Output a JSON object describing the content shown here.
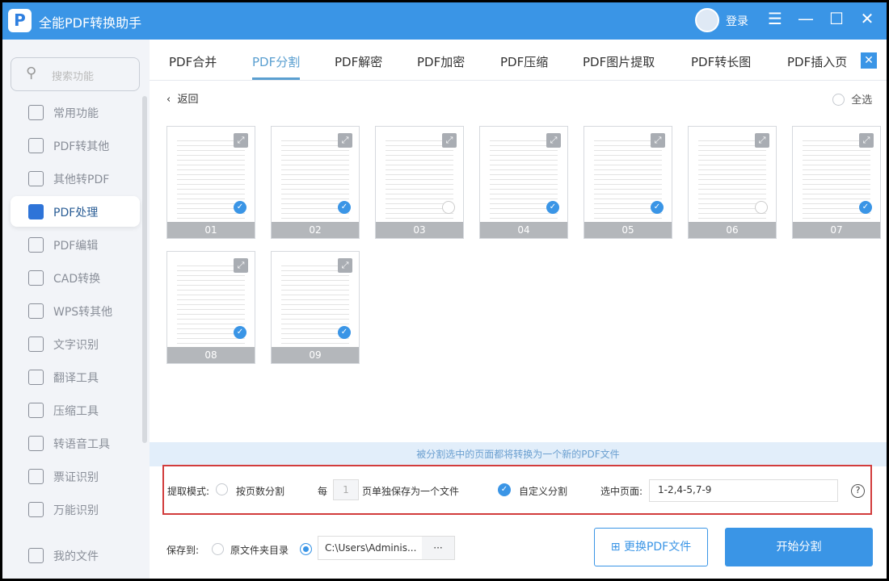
{
  "app": {
    "title": "全能PDF转换助手",
    "logo": "P",
    "login": "登录"
  },
  "window": {
    "menu": "☰",
    "min": "—",
    "max": "☐",
    "close": "✕"
  },
  "sidebar": {
    "search_placeholder": "搜索功能",
    "items": [
      {
        "label": "常用功能",
        "icon": "home-icon"
      },
      {
        "label": "PDF转其他",
        "icon": "pdf-convert-icon"
      },
      {
        "label": "其他转PDF",
        "icon": "to-pdf-icon"
      },
      {
        "label": "PDF处理",
        "icon": "pdf-process-icon",
        "active": true
      },
      {
        "label": "PDF编辑",
        "icon": "pdf-edit-icon"
      },
      {
        "label": "CAD转换",
        "icon": "cad-icon"
      },
      {
        "label": "WPS转其他",
        "icon": "wps-icon"
      },
      {
        "label": "文字识别",
        "icon": "ocr-icon"
      },
      {
        "label": "翻译工具",
        "icon": "translate-icon"
      },
      {
        "label": "压缩工具",
        "icon": "compress-icon"
      },
      {
        "label": "转语音工具",
        "icon": "voice-icon"
      },
      {
        "label": "票证识别",
        "icon": "ticket-icon"
      },
      {
        "label": "万能识别",
        "icon": "scan-icon"
      }
    ],
    "my_files": "我的文件"
  },
  "tabs": [
    "PDF合并",
    "PDF分割",
    "PDF解密",
    "PDF加密",
    "PDF压缩",
    "PDF图片提取",
    "PDF转长图",
    "PDF插入页"
  ],
  "active_tab": 1,
  "back": "返回",
  "select_all": "全选",
  "pages": [
    {
      "num": "01",
      "checked": true
    },
    {
      "num": "02",
      "checked": true
    },
    {
      "num": "03",
      "checked": false
    },
    {
      "num": "04",
      "checked": true
    },
    {
      "num": "05",
      "checked": true
    },
    {
      "num": "06",
      "checked": false
    },
    {
      "num": "07",
      "checked": true
    },
    {
      "num": "08",
      "checked": true
    },
    {
      "num": "09",
      "checked": true
    }
  ],
  "banner": "被分割选中的页面都将转换为一个新的PDF文件",
  "options": {
    "mode_label": "提取模式:",
    "by_pages": "按页数分割",
    "every": "每",
    "every_value": "1",
    "every_suffix": "页单独保存为一个文件",
    "custom": "自定义分割",
    "selected_label": "选中页面:",
    "selected_value": "1-2,4-5,7-9",
    "help": "?"
  },
  "save": {
    "label": "保存到:",
    "original": "原文件夹目录",
    "path": "C:\\Users\\Adminis...",
    "browse": "···"
  },
  "buttons": {
    "change": "更换PDF文件",
    "start": "开始分割"
  },
  "colors": {
    "primary": "#3a95e6",
    "highlight": "#d23c3c"
  }
}
